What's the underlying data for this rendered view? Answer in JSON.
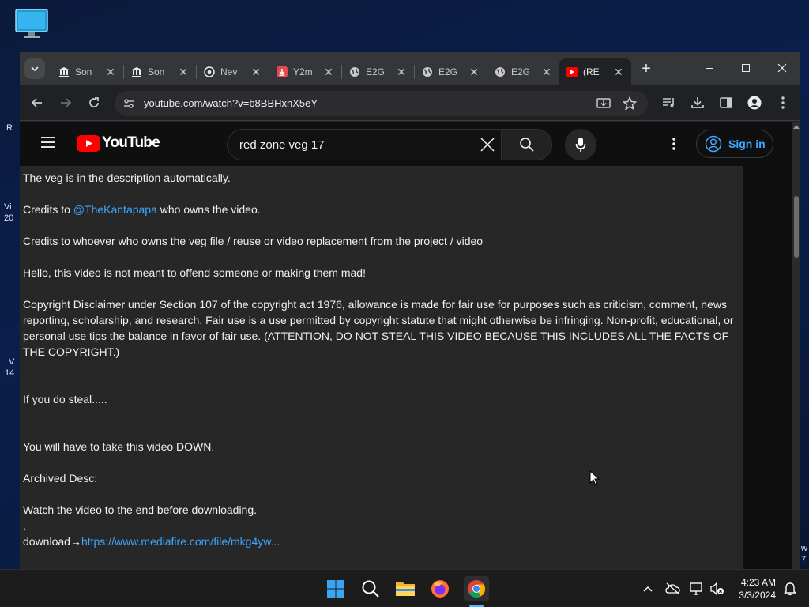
{
  "desktop": {
    "fragments": [
      "R",
      "Vi",
      "20",
      "V",
      "14",
      "w",
      "7"
    ]
  },
  "browser": {
    "tabs": [
      {
        "label": "Son",
        "icon": "bank-icon"
      },
      {
        "label": "Son",
        "icon": "bank-icon"
      },
      {
        "label": "Nev",
        "icon": "chrome-icon"
      },
      {
        "label": "Y2m",
        "icon": "download-app-icon"
      },
      {
        "label": "E2G",
        "icon": "globe-icon"
      },
      {
        "label": "E2G",
        "icon": "globe-icon"
      },
      {
        "label": "E2G",
        "icon": "globe-icon"
      },
      {
        "label": "(RE",
        "icon": "youtube-icon"
      }
    ],
    "url": "youtube.com/watch?v=b8BBHxnX5eY"
  },
  "youtube": {
    "logo_text": "YouTube",
    "search_value": "red zone veg 17",
    "signin_label": "Sign in",
    "description": {
      "line1": "The veg is in the description automatically.",
      "credits_prefix": "Credits to ",
      "credits_handle": "@TheKantapapa",
      "credits_suffix": " who owns the video.",
      "credits2": "Credits to whoever who owns the veg file / reuse or video replacement from the project / video",
      "hello": "Hello, this video is not meant to offend someone or making them mad!",
      "copyright": "Copyright Disclaimer under Section 107 of the copyright act 1976, allowance is made for fair use for purposes such as criticism, comment, news reporting, scholarship, and research. Fair use is a use permitted by copyright statute that might otherwise be infringing. Non-profit, educational, or personal use tips the balance in favor of fair use. (ATTENTION, DO NOT STEAL THIS VIDEO BECAUSE THIS INCLUDES ALL THE FACTS OF THE COPYRIGHT.)",
      "steal": "If you do steal.....",
      "down": "You will have to take this video DOWN.",
      "archived": "Archived Desc:",
      "watch": "Watch the video to the end before downloading.",
      "dot": ".",
      "download_prefix": "download→",
      "download_link": "https://www.mediafire.com/file/mkg4yw..."
    }
  },
  "taskbar": {
    "time": "4:23 AM",
    "date": "3/3/2024"
  },
  "colors": {
    "link": "#3ea6ff",
    "youtube_red": "#ff0000",
    "chrome_bg": "#202124"
  }
}
